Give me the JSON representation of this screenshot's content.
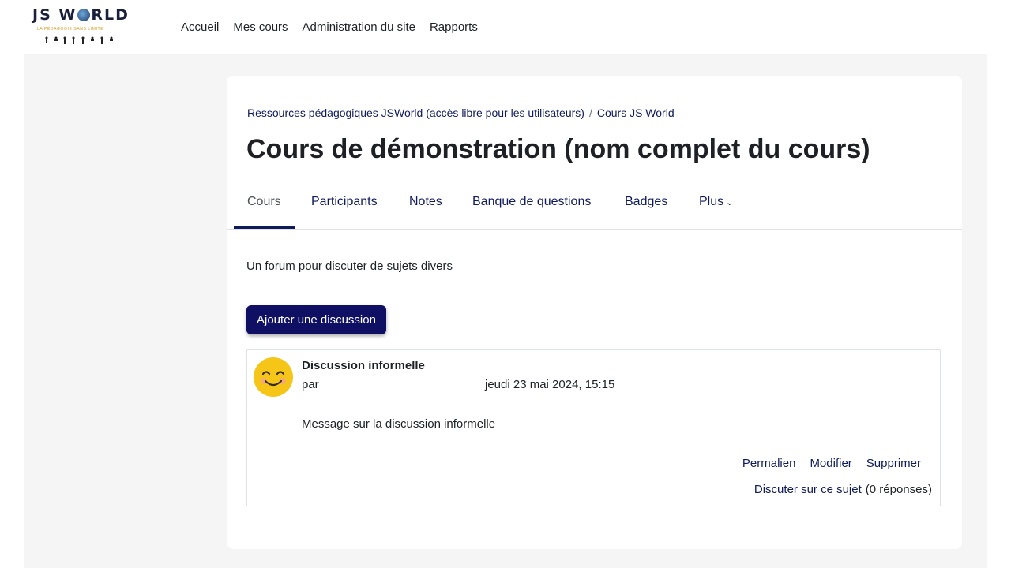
{
  "logo": {
    "title": "JS WORLD",
    "title_left": "JS W",
    "title_right": "RLD",
    "tagline": "LA PÉDAGOGIE SANS LIMITE"
  },
  "nav": {
    "items": [
      "Accueil",
      "Mes cours",
      "Administration du site",
      "Rapports"
    ]
  },
  "breadcrumb": {
    "items": [
      "Ressources pédagogiques JSWorld (accès libre pour les utilisateurs)",
      "Cours JS World"
    ],
    "separator": "/"
  },
  "page": {
    "title": "Cours de démonstration (nom complet du cours)"
  },
  "tabs": {
    "items": [
      "Cours",
      "Participants",
      "Notes",
      "Banque de questions",
      "Badges",
      "Plus"
    ],
    "active": "Cours"
  },
  "forum": {
    "description": "Un forum pour discuter de sujets divers",
    "add_button": "Ajouter une discussion"
  },
  "post": {
    "subject": "Discussion informelle",
    "by": "par",
    "date": "jeudi 23 mai 2024, 15:15",
    "message": "Message sur la discussion informelle",
    "actions": [
      "Permalien",
      "Modifier",
      "Supprimer"
    ],
    "reply_label": "Discuter sur ce sujet",
    "reply_count": "(0 réponses)"
  },
  "colors": {
    "brand_dark": "#0f0f64",
    "link": "#0f1b5c",
    "page_bg": "#f5f5f5",
    "avatar": "#f5c518"
  }
}
